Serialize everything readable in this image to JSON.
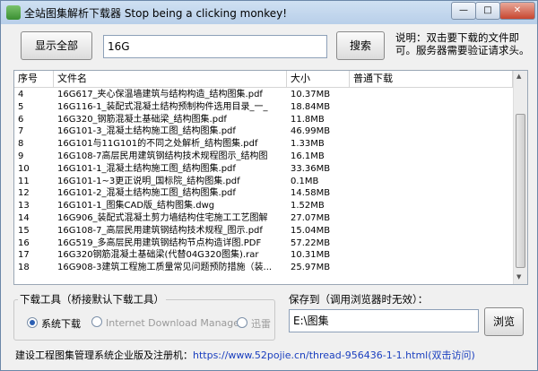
{
  "window": {
    "title": "全站图集解析下载器 Stop being a clicking monkey!"
  },
  "toolbar": {
    "show_all_label": "显示全部",
    "search_value": "16G",
    "search_label": "搜索",
    "hint": "说明：双击要下载的文件即可。服务器需要验证请求头。"
  },
  "table": {
    "headers": [
      "序号",
      "文件名",
      "大小",
      "普通下载"
    ],
    "rows": [
      {
        "no": "4",
        "name": "16G617_夹心保温墙建筑与结构构造_结构图集.pdf",
        "size": "10.37MB",
        "dl": ""
      },
      {
        "no": "5",
        "name": "16G116-1_装配式混凝土结构预制构件选用目录_一_",
        "size": "18.84MB",
        "dl": ""
      },
      {
        "no": "6",
        "name": "16G320_钢筋混凝土基础梁_结构图集.pdf",
        "size": "11.8MB",
        "dl": ""
      },
      {
        "no": "7",
        "name": "16G101-3_混凝土结构施工图_结构图集.pdf",
        "size": "46.99MB",
        "dl": ""
      },
      {
        "no": "8",
        "name": "16G101与11G101的不同之处解析_结构图集.pdf",
        "size": "1.33MB",
        "dl": ""
      },
      {
        "no": "9",
        "name": "16G108-7高层民用建筑钢结构技术规程图示_结构图",
        "size": "16.1MB",
        "dl": ""
      },
      {
        "no": "10",
        "name": "16G101-1_混凝土结构施工图_结构图集.pdf",
        "size": "33.36MB",
        "dl": ""
      },
      {
        "no": "11",
        "name": "16G101-1~3更正说明_国标院_结构图集.pdf",
        "size": "0.1MB",
        "dl": ""
      },
      {
        "no": "12",
        "name": "16G101-2_混凝土结构施工图_结构图集.pdf",
        "size": "14.58MB",
        "dl": ""
      },
      {
        "no": "13",
        "name": "16G101-1_图集CAD版_结构图集.dwg",
        "size": "1.52MB",
        "dl": ""
      },
      {
        "no": "14",
        "name": "16G906_装配式混凝土剪力墙结构住宅施工工艺图解",
        "size": "27.07MB",
        "dl": ""
      },
      {
        "no": "15",
        "name": "16G108-7_高层民用建筑钢结构技术规程_图示.pdf",
        "size": "15.04MB",
        "dl": ""
      },
      {
        "no": "16",
        "name": "16G519_多高层民用建筑钢结构节点构造详图.PDF",
        "size": "57.22MB",
        "dl": ""
      },
      {
        "no": "17",
        "name": "16G320钢筋混凝土基础梁(代替04G320图集).rar",
        "size": "10.31MB",
        "dl": ""
      },
      {
        "no": "18",
        "name": "16G908-3建筑工程施工质量常见问题预防措施（装...",
        "size": "25.97MB",
        "dl": ""
      }
    ]
  },
  "tools": {
    "group_label": "下载工具（桥接默认下载工具）",
    "options": [
      {
        "label": "系统下载",
        "selected": true,
        "enabled": true
      },
      {
        "label": "Internet Download Manager",
        "selected": false,
        "enabled": false
      },
      {
        "label": "迅雷",
        "selected": false,
        "enabled": false
      }
    ]
  },
  "save": {
    "group_label": "保存到（调用浏览器时无效）：",
    "path_value": "E:\\图集",
    "browse_label": "浏览"
  },
  "footer": {
    "label": "建设工程图集管理系统企业版及注册机：",
    "url": "https://www.52pojie.cn/thread-956436-1-1.html",
    "visit": "(双击访问)"
  }
}
